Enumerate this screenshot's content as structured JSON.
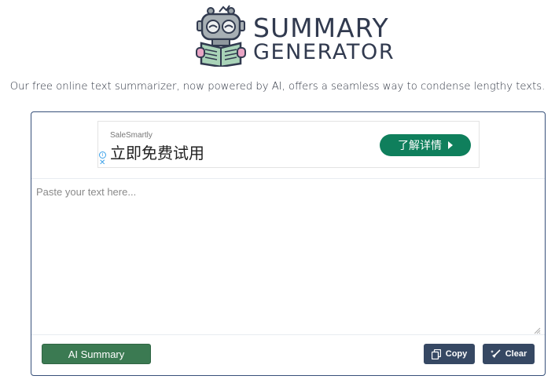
{
  "logo": {
    "line1": "SUMMARY",
    "line2": "GENERATOR",
    "icon": "robot-reading-book-icon"
  },
  "tagline": "Our free online text summarizer, now powered by AI, offers a seamless way to condense lengthy texts.",
  "ad": {
    "brand": "SaleSmartly",
    "headline": "立即免费试用",
    "button_label": "了解详情",
    "info_icon": "info-icon",
    "close_icon": "close-icon"
  },
  "editor": {
    "placeholder": "Paste your text here..."
  },
  "actions": {
    "summary_label": "AI Summary",
    "copy_label": "Copy",
    "clear_label": "Clear",
    "copy_icon": "copy-icon",
    "clear_icon": "broom-icon"
  },
  "colors": {
    "brand_text": "#313a4f",
    "card_border": "#37507a",
    "summary_button": "#3b7a52",
    "dark_button": "#364863",
    "ad_button": "#0f7f5c"
  }
}
